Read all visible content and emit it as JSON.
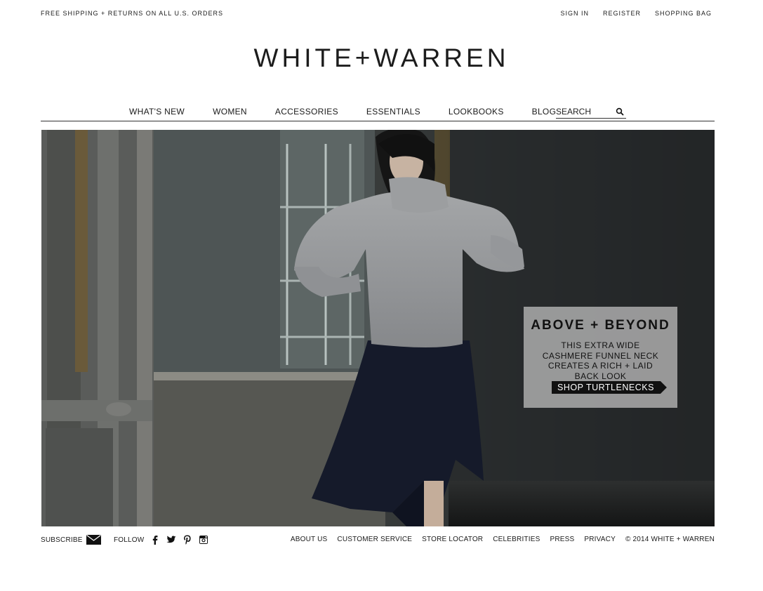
{
  "topbar": {
    "promo": "FREE SHIPPING + RETURNS ON ALL U.S. ORDERS",
    "sign_in": "SIGN IN",
    "register": "REGISTER",
    "shopping_bag": "SHOPPING BAG"
  },
  "logo": {
    "text": "WHITE+WARREN"
  },
  "nav": {
    "items": [
      "WHAT'S NEW",
      "WOMEN",
      "ACCESSORIES",
      "ESSENTIALS",
      "LOOKBOOKS",
      "BLOG"
    ],
    "search_placeholder": "SEARCH",
    "search_icon": "search-icon"
  },
  "hero": {
    "headline": "ABOVE + BEYOND",
    "copy": "THIS EXTRA WIDE CASHMERE FUNNEL NECK CREATES A RICH + LAID BACK LOOK",
    "cta": "SHOP TURTLENECKS"
  },
  "footer": {
    "subscribe": "SUBSCRIBE",
    "follow": "FOLLOW",
    "social_icons": [
      "facebook-icon",
      "twitter-icon",
      "pinterest-icon",
      "instagram-icon"
    ],
    "links": [
      "ABOUT US",
      "CUSTOMER SERVICE",
      "STORE LOCATOR",
      "CELEBRITIES",
      "PRESS",
      "PRIVACY"
    ],
    "copyright": "© 2014 WHITE + WARREN"
  },
  "colors": {
    "text": "#1a1a1a",
    "promo_box": "#b9b9b9",
    "cta_bg": "#111111",
    "hero_dark": "#2a2d2e"
  }
}
